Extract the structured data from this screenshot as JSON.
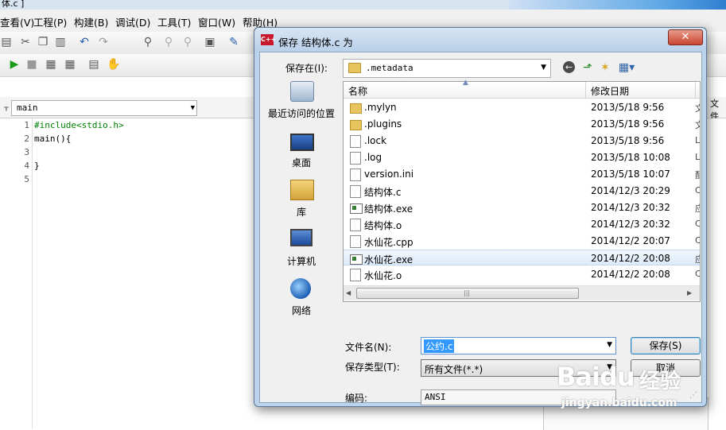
{
  "ide": {
    "title_fragment": "体.c ]",
    "menu": [
      "查看(V)",
      "工程(P)",
      "构建(B)",
      "调试(D)",
      "工具(T)",
      "窗口(W)",
      "帮助(H)"
    ],
    "function_combo": "main",
    "right_tab": "文件",
    "code_lines": [
      {
        "num": "1",
        "text": "#include<stdio.h>"
      },
      {
        "num": "2",
        "text": "main(){"
      },
      {
        "num": "3",
        "text": ""
      },
      {
        "num": "4",
        "text": "}"
      },
      {
        "num": "5",
        "text": ""
      }
    ]
  },
  "dialog": {
    "title": "保存 结构体.c 为",
    "app_icon": "C++",
    "close": "✕",
    "save_in_label": "保存在(I):",
    "save_in_value": ".metadata",
    "places": [
      {
        "label": "最近访问的位置",
        "icon": "recent-places-icon"
      },
      {
        "label": "桌面",
        "icon": "desktop-icon"
      },
      {
        "label": "库",
        "icon": "library-icon"
      },
      {
        "label": "计算机",
        "icon": "computer-icon"
      },
      {
        "label": "网络",
        "icon": "network-icon"
      }
    ],
    "columns": {
      "name": "名称",
      "date": "修改日期"
    },
    "files": [
      {
        "name": ".mylyn",
        "date": "2013/5/18 9:56",
        "type": "文",
        "kind": "folder"
      },
      {
        "name": ".plugins",
        "date": "2013/5/18 9:56",
        "type": "文",
        "kind": "folder"
      },
      {
        "name": ".lock",
        "date": "2013/5/18 9:56",
        "type": "L",
        "kind": "file"
      },
      {
        "name": ".log",
        "date": "2013/5/18 10:08",
        "type": "L",
        "kind": "file"
      },
      {
        "name": "version.ini",
        "date": "2013/5/18 10:07",
        "type": "配",
        "kind": "cfg"
      },
      {
        "name": "结构体.c",
        "date": "2014/12/3 20:29",
        "type": "C",
        "kind": "file"
      },
      {
        "name": "结构体.exe",
        "date": "2014/12/3 20:32",
        "type": "应",
        "kind": "exe"
      },
      {
        "name": "结构体.o",
        "date": "2014/12/3 20:32",
        "type": "C",
        "kind": "file"
      },
      {
        "name": "水仙花.cpp",
        "date": "2014/12/2 20:07",
        "type": "C",
        "kind": "file"
      },
      {
        "name": "水仙花.exe",
        "date": "2014/12/2 20:08",
        "type": "应",
        "kind": "exe"
      },
      {
        "name": "水仙花.o",
        "date": "2014/12/2 20:08",
        "type": "C",
        "kind": "file"
      }
    ],
    "selected_index": 9,
    "filename_label": "文件名(N):",
    "filename_value": "公约.c",
    "filetype_label": "保存类型(T):",
    "filetype_value": "所有文件(*.*)",
    "encoding_label": "编码:",
    "encoding_value": "ANSI",
    "save_button": "保存(S)",
    "cancel_button": "取消"
  },
  "watermark": {
    "logo": "Baidu",
    "text": "经验",
    "url": "jingyan.baidu.com"
  },
  "colors": {
    "accent": "#3399ff",
    "dialog_frame": "#bcd3ec",
    "close_red": "#c9462f"
  }
}
